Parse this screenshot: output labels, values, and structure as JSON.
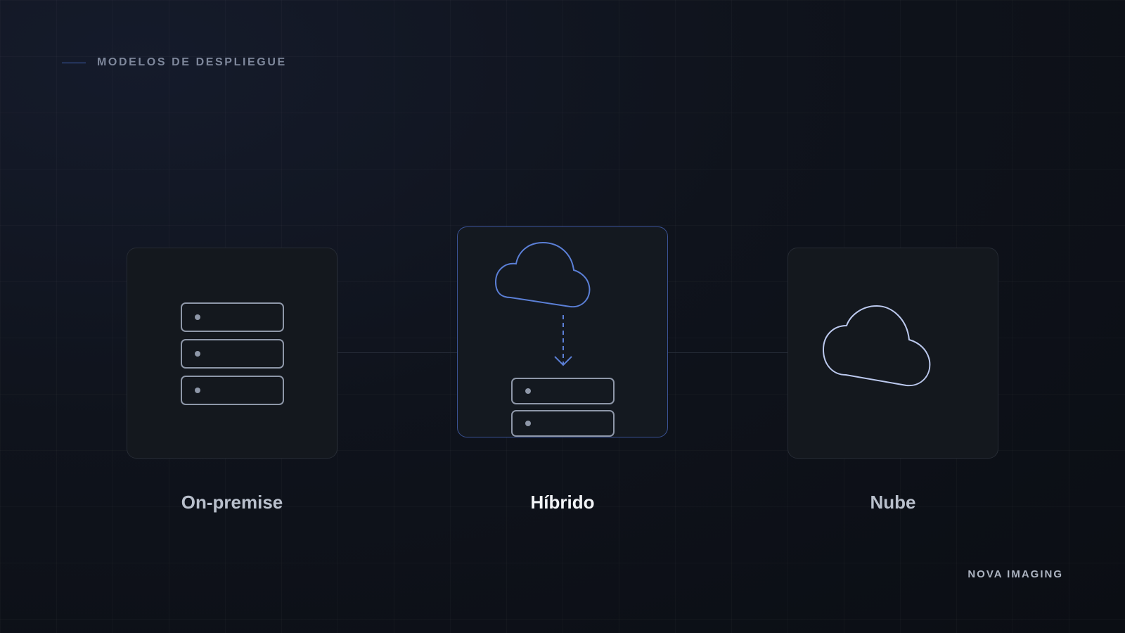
{
  "header": {
    "eyebrow": "MODELOS DE DESPLIEGUE"
  },
  "models": [
    {
      "label": "On-premise",
      "icon": "server-rack-icon",
      "active": false
    },
    {
      "label": "Híbrido",
      "icon": "cloud-to-server-icon",
      "active": true
    },
    {
      "label": "Nube",
      "icon": "cloud-icon",
      "active": false
    }
  ],
  "footer": {
    "brand": "NOVA IMAGING"
  },
  "colors": {
    "accent": "#5b7fd6",
    "icon_stroke": "#8e97a8",
    "cloud_stroke": "#bcc9ee",
    "active_border": "#3a5294"
  }
}
